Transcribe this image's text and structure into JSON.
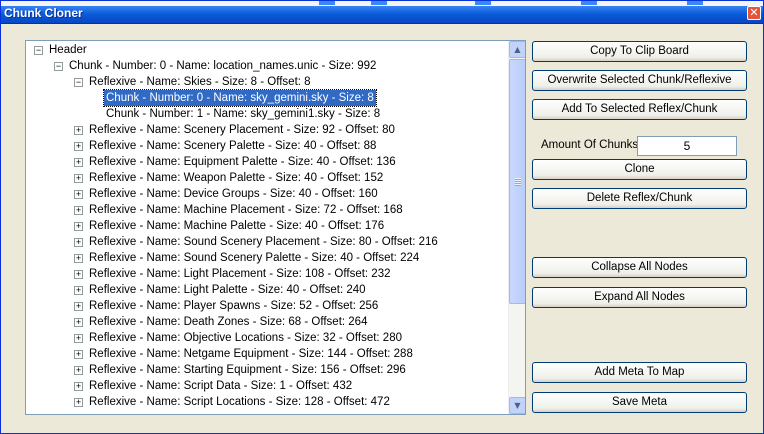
{
  "window": {
    "title": "Chunk Cloner"
  },
  "tree": {
    "rows": [
      {
        "depth": 0,
        "expander": "minus",
        "label": "Header"
      },
      {
        "depth": 1,
        "expander": "minus",
        "label": "Chunk - Number: 0 - Name: location_names.unic - Size: 992"
      },
      {
        "depth": 2,
        "expander": "minus",
        "label": "Reflexive - Name: Skies - Size: 8 - Offset: 8"
      },
      {
        "depth": 3,
        "expander": "none",
        "label": "Chunk - Number: 0 - Name: sky_gemini.sky  - Size: 8",
        "selected": true
      },
      {
        "depth": 3,
        "expander": "none",
        "label": "Chunk - Number: 1 - Name: sky_gemini1.sky  - Size: 8"
      },
      {
        "depth": 2,
        "expander": "plus",
        "label": "Reflexive - Name: Scenery Placement - Size: 92 - Offset: 80"
      },
      {
        "depth": 2,
        "expander": "plus",
        "label": "Reflexive - Name: Scenery Palette - Size: 40 - Offset: 88"
      },
      {
        "depth": 2,
        "expander": "plus",
        "label": "Reflexive - Name: Equipment Palette - Size: 40 - Offset: 136"
      },
      {
        "depth": 2,
        "expander": "plus",
        "label": "Reflexive - Name: Weapon Palette - Size: 40 - Offset: 152"
      },
      {
        "depth": 2,
        "expander": "plus",
        "label": "Reflexive - Name: Device Groups - Size: 40 - Offset: 160"
      },
      {
        "depth": 2,
        "expander": "plus",
        "label": "Reflexive - Name: Machine Placement - Size: 72 - Offset: 168"
      },
      {
        "depth": 2,
        "expander": "plus",
        "label": "Reflexive - Name: Machine Palette - Size: 40 - Offset: 176"
      },
      {
        "depth": 2,
        "expander": "plus",
        "label": "Reflexive - Name: Sound Scenery Placement - Size: 80 - Offset: 216"
      },
      {
        "depth": 2,
        "expander": "plus",
        "label": "Reflexive - Name: Sound Scenery Palette - Size: 40 - Offset: 224"
      },
      {
        "depth": 2,
        "expander": "plus",
        "label": "Reflexive - Name: Light Placement - Size: 108 - Offset: 232"
      },
      {
        "depth": 2,
        "expander": "plus",
        "label": "Reflexive - Name: Light Palette - Size: 40 - Offset: 240"
      },
      {
        "depth": 2,
        "expander": "plus",
        "label": "Reflexive - Name: Player Spawns - Size: 52 - Offset: 256"
      },
      {
        "depth": 2,
        "expander": "plus",
        "label": "Reflexive - Name: Death Zones - Size: 68 - Offset: 264"
      },
      {
        "depth": 2,
        "expander": "plus",
        "label": "Reflexive - Name: Objective Locations - Size: 32 - Offset: 280"
      },
      {
        "depth": 2,
        "expander": "plus",
        "label": "Reflexive - Name: Netgame Equipment - Size: 144 - Offset: 288"
      },
      {
        "depth": 2,
        "expander": "plus",
        "label": "Reflexive - Name: Starting Equipment - Size: 156 - Offset: 296"
      },
      {
        "depth": 2,
        "expander": "plus",
        "label": "Reflexive - Name: Script Data - Size: 1 - Offset: 432"
      },
      {
        "depth": 2,
        "expander": "plus",
        "label": "Reflexive - Name: Script Locations - Size: 128 - Offset: 472"
      }
    ]
  },
  "buttons": {
    "copy": "Copy To Clip Board",
    "overwrite": "Overwrite Selected Chunk/Reflexive",
    "add": "Add To Selected Reflex/Chunk",
    "clone": "Clone",
    "delete": "Delete Reflex/Chunk",
    "collapse": "Collapse All Nodes",
    "expand": "Expand All Nodes",
    "add_meta": "Add Meta To Map",
    "save_meta": "Save Meta"
  },
  "amount": {
    "label": "Amount Of Chunks:",
    "value": "5"
  },
  "icons": {
    "close": "close-icon",
    "scroll_up": "scroll-up-icon",
    "scroll_down": "scroll-down-icon"
  }
}
